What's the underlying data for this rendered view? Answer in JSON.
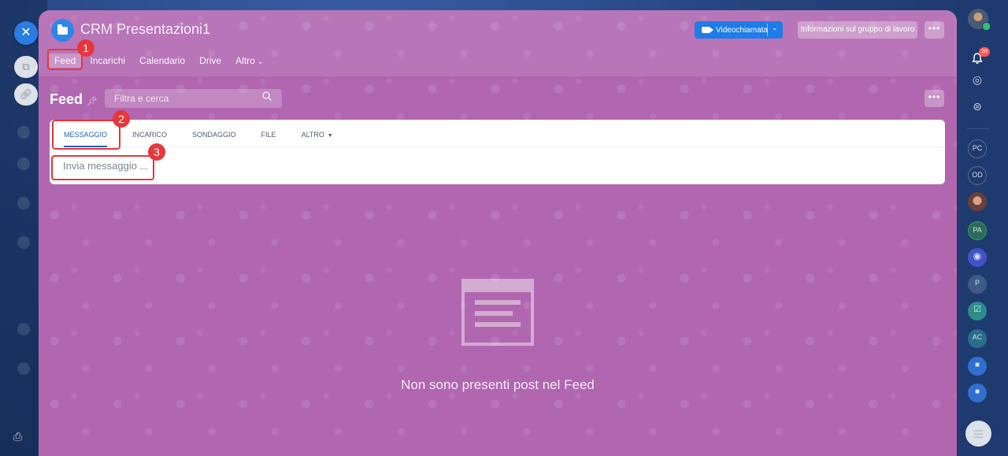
{
  "window": {
    "close_icon": "close-icon"
  },
  "group": {
    "title": "CRM Presentazioni1",
    "tabs": [
      {
        "label": "Feed",
        "active": true
      },
      {
        "label": "Incarichi"
      },
      {
        "label": "Calendario"
      },
      {
        "label": "Drive"
      },
      {
        "label": "Altro"
      }
    ],
    "video_button": "Videochiamata",
    "info_button": "Informazioni sul gruppo di lavoro",
    "more": "•••"
  },
  "feed": {
    "title": "Feed",
    "search_placeholder": "Filtra e cerca",
    "more": "•••"
  },
  "composer": {
    "tabs": [
      "MESSAGGIO",
      "INCARICO",
      "SONDAGGIO",
      "FILE",
      "ALTRO"
    ],
    "active_tab": "MESSAGGIO",
    "placeholder": "Invia messaggio ..."
  },
  "callouts": [
    "1",
    "2",
    "3"
  ],
  "empty_state": {
    "text": "Non sono presenti post nel Feed"
  },
  "right_sidebar": {
    "notifications_count": "28",
    "contacts": [
      "PC",
      "OD",
      "PA",
      "P",
      "AC"
    ]
  },
  "colors": {
    "panel_bg": "#b067b0",
    "accent_blue": "#1e7ce8",
    "callout_red": "#e8373c"
  }
}
